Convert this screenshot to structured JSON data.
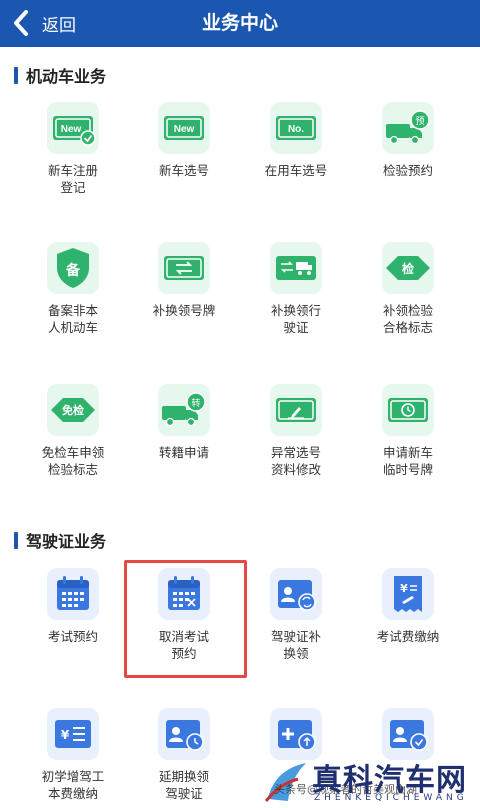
{
  "header": {
    "back_label": "返回",
    "title": "业务中心"
  },
  "sections": {
    "vehicle": {
      "title": "机动车业务"
    },
    "license": {
      "title": "驾驶证业务"
    }
  },
  "vehicle_tiles": [
    {
      "label": "新车注册\n登记",
      "icon": "new-car-registration-icon"
    },
    {
      "label": "新车选号",
      "icon": "new-plate-icon"
    },
    {
      "label": "在用车选号",
      "icon": "number-plate-icon"
    },
    {
      "label": "检验预约",
      "icon": "inspection-truck-icon"
    },
    {
      "label": "备案非本\n人机动车",
      "icon": "shield-record-icon"
    },
    {
      "label": "补换领号牌",
      "icon": "replace-plate-icon"
    },
    {
      "label": "补换领行\n驶证",
      "icon": "replace-driving-permit-icon"
    },
    {
      "label": "补领检验\n合格标志",
      "icon": "inspection-badge-icon"
    },
    {
      "label": "免检车申领\n检验标志",
      "icon": "exempt-badge-icon"
    },
    {
      "label": "转籍申请",
      "icon": "transfer-truck-icon"
    },
    {
      "label": "异常选号\n资料修改",
      "icon": "edit-plate-icon"
    },
    {
      "label": "申请新车\n临时号牌",
      "icon": "temp-plate-clock-icon"
    }
  ],
  "license_tiles": [
    {
      "label": "考试预约",
      "icon": "calendar-icon"
    },
    {
      "label": "取消考试\n预约",
      "icon": "calendar-cancel-icon"
    },
    {
      "label": "驾驶证补\n换领",
      "icon": "license-renew-icon"
    },
    {
      "label": "考试费缴纳",
      "icon": "fee-receipt-icon"
    },
    {
      "label": "初学增驾工\n本费缴纳",
      "icon": "fee-card-icon"
    },
    {
      "label": "延期换领\n驾驶证",
      "icon": "license-clock-icon"
    },
    {
      "label": "",
      "icon": "license-upload-icon"
    },
    {
      "label": "",
      "icon": "license-check-icon"
    }
  ],
  "watermark": {
    "main": "真科汽车网",
    "sub": "ZHENKEQICHEWANG",
    "source": "头条号@观察者的哲美观山湖"
  },
  "colors": {
    "header": "#1b57b1",
    "green_accent": "#2fb36c",
    "blue_accent": "#3a78e0",
    "highlight": "#e24845"
  }
}
